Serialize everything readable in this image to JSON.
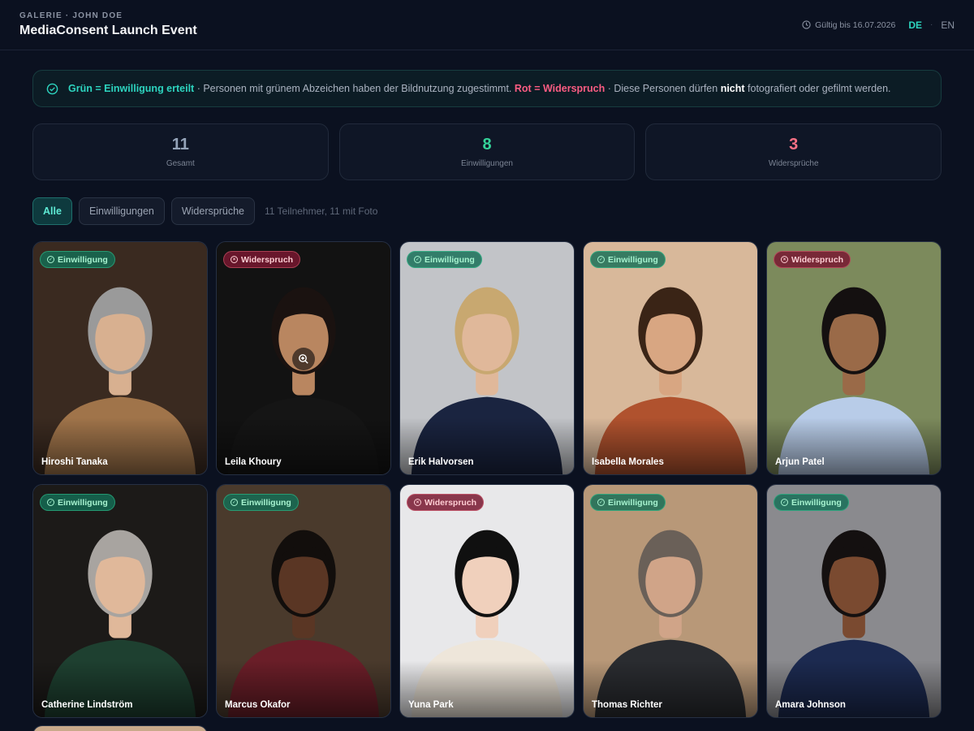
{
  "header": {
    "eyebrow": "GALERIE · JOHN DOE",
    "title": "MediaConsent Launch Event",
    "valid_until": "Gültig bis 16.07.2026",
    "lang_active": "DE",
    "lang_separator": "·",
    "lang_inactive": "EN"
  },
  "banner": {
    "green_label": "Grün = Einwilligung erteilt",
    "text1": " · Personen mit grünem Abzeichen haben der Bildnutzung zugestimmt. ",
    "red_label": "Rot = Widerspruch",
    "text2": " · Diese Personen dürfen ",
    "emphasis": "nicht",
    "text3": " fotografiert oder gefilmt werden."
  },
  "stats": [
    {
      "value": "11",
      "label": "Gesamt"
    },
    {
      "value": "8",
      "label": "Einwilligungen"
    },
    {
      "value": "3",
      "label": "Widersprüche"
    }
  ],
  "filters": {
    "all": "Alle",
    "consents": "Einwilligungen",
    "objections": "Widersprüche",
    "info": "11 Teilnehmer, 11 mit Foto"
  },
  "badges": {
    "ok": "Einwilligung",
    "no": "Widerspruch"
  },
  "people": [
    {
      "name": "Hiroshi Tanaka",
      "status": "ok",
      "bg": "#3a2a20",
      "skin": "#d8b090",
      "hair": "#9a9a9a",
      "top": "#a0744a"
    },
    {
      "name": "Leila Khoury",
      "status": "no",
      "bg": "#121212",
      "skin": "#b98660",
      "hair": "#1a1210",
      "top": "#151515"
    },
    {
      "name": "Erik Halvorsen",
      "status": "ok",
      "bg": "#c2c4c8",
      "skin": "#e0b89a",
      "hair": "#c8a870",
      "top": "#1a2440"
    },
    {
      "name": "Isabella Morales",
      "status": "ok",
      "bg": "#d8b89a",
      "skin": "#d8a682",
      "hair": "#3a2416",
      "top": "#b0522e"
    },
    {
      "name": "Arjun Patel",
      "status": "no",
      "bg": "#7c8a5c",
      "skin": "#9a6a48",
      "hair": "#141010",
      "top": "#b8cce8"
    },
    {
      "name": "Catherine Lindström",
      "status": "ok",
      "bg": "#1c1a18",
      "skin": "#e0b89a",
      "hair": "#a8a4a0",
      "top": "#1e4030"
    },
    {
      "name": "Marcus Okafor",
      "status": "ok",
      "bg": "#4a3a2c",
      "skin": "#5a3624",
      "hair": "#120e0c",
      "top": "#6a1e28"
    },
    {
      "name": "Yuna Park",
      "status": "no",
      "bg": "#e8e8ea",
      "skin": "#f0d0bc",
      "hair": "#101010",
      "top": "#eee6da"
    },
    {
      "name": "Thomas Richter",
      "status": "ok",
      "bg": "#b89878",
      "skin": "#d0a488",
      "hair": "#6a6058",
      "top": "#2a2c30"
    },
    {
      "name": "Amara Johnson",
      "status": "ok",
      "bg": "#8a8a8e",
      "skin": "#7a4a30",
      "hair": "#141010",
      "top": "#1c2a50"
    }
  ]
}
